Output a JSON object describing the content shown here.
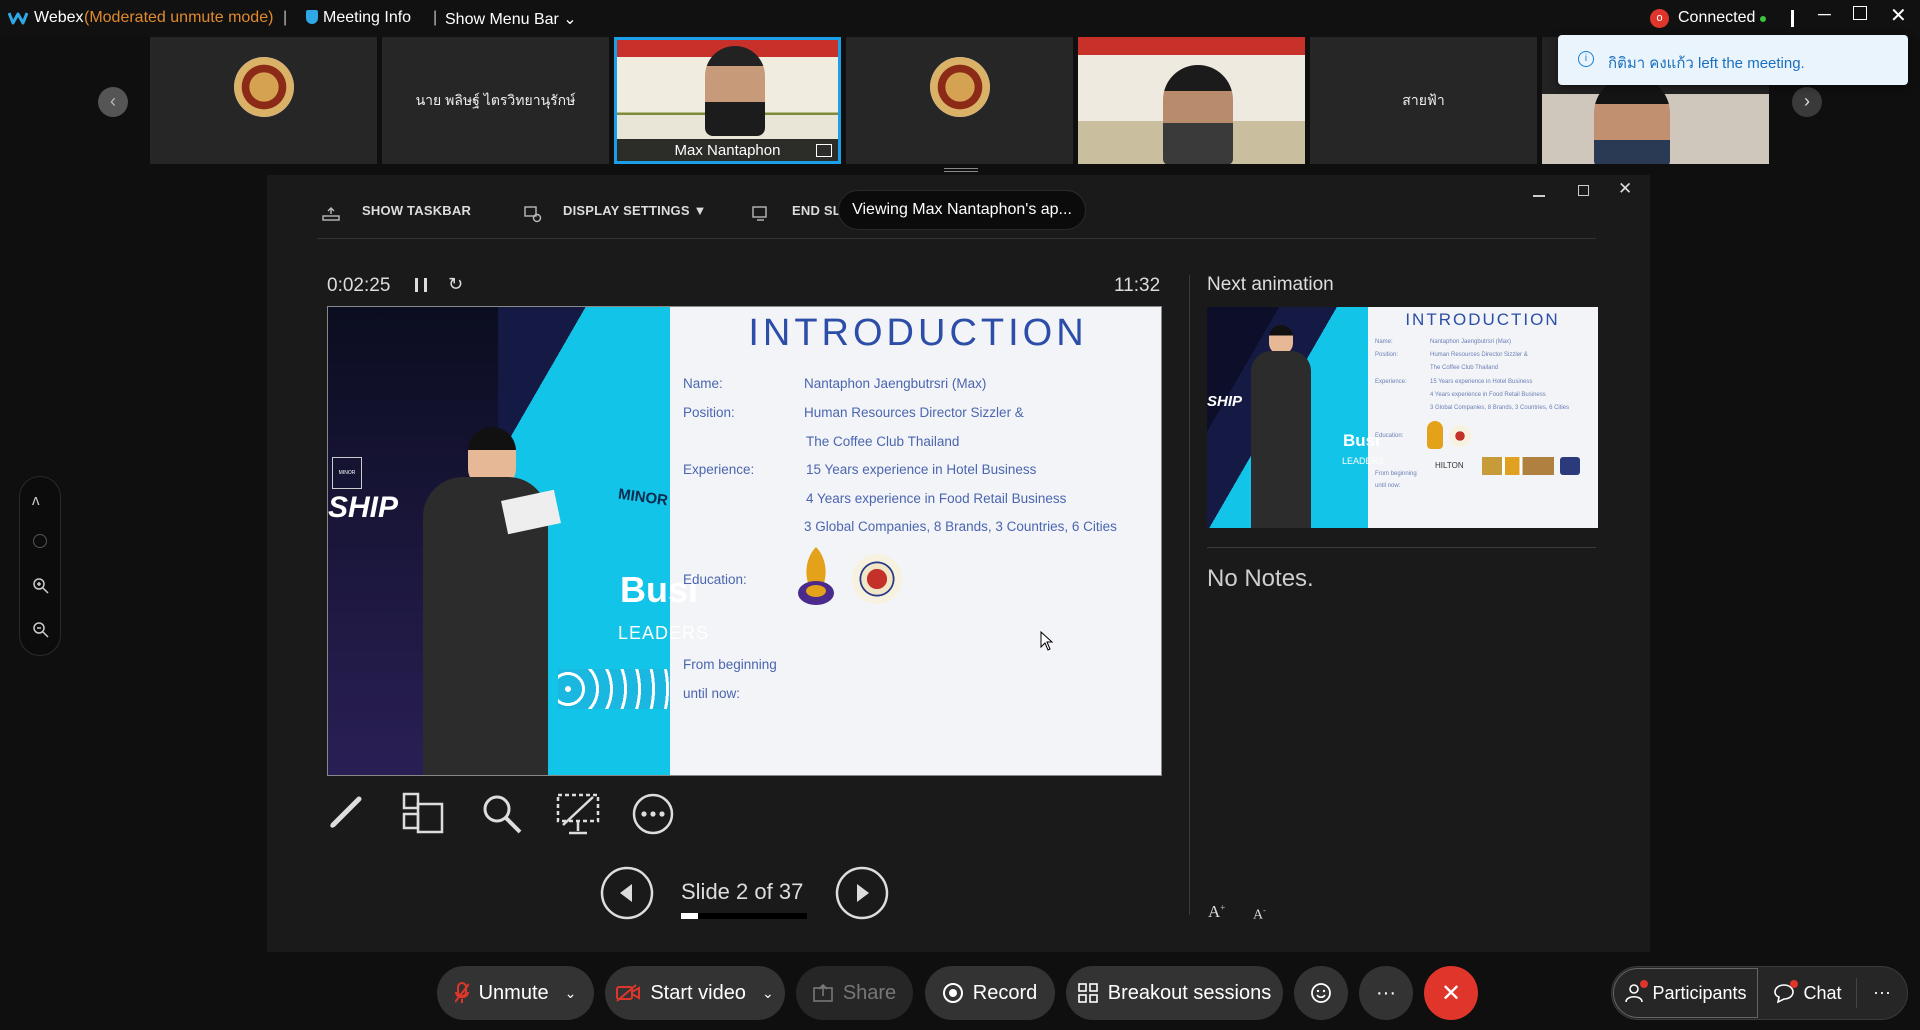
{
  "titlebar": {
    "app_name": "Webex",
    "mode": "(Moderated unmute mode)",
    "separator": "|",
    "meeting_info": "Meeting Info",
    "show_menu_bar": "Show Menu Bar",
    "connected": "Connected"
  },
  "toast": {
    "message": "กิติมา คงแก้ว left the meeting."
  },
  "filmstrip": {
    "tiles": [
      {
        "label": ""
      },
      {
        "label": "นาย พลิษฐ์ ไตรวิทยานุรักษ์"
      },
      {
        "label": "Max Nantaphon"
      },
      {
        "label": ""
      },
      {
        "label": ""
      },
      {
        "label": "สายฟ้า"
      },
      {
        "label": ""
      }
    ]
  },
  "presenter": {
    "show_taskbar": "SHOW TASKBAR",
    "display_settings": "DISPLAY SETTINGS ▼",
    "end_slideshow": "END SL",
    "viewing_banner": "Viewing Max Nantaphon's ap...",
    "elapsed": "0:02:25",
    "clock": "11:32",
    "next_animation": "Next animation",
    "notes": "No Notes.",
    "slide_counter": "Slide 2 of 37",
    "progress": 0.027
  },
  "slide": {
    "title": "INTRODUCTION",
    "photo_text_left": "SHIP",
    "photo_text_minor": "MINOR",
    "photo_text_bus": "Busi",
    "photo_text_leaders": "LEADERS",
    "name_label": "Name:",
    "name_value": "Nantaphon Jaengbutrsri (Max)",
    "position_label": "Position:",
    "position_value_1": "Human Resources Director Sizzler &",
    "position_value_2": "The Coffee Club Thailand",
    "experience_label": "Experience:",
    "experience_1": "15 Years experience in Hotel Business",
    "experience_2": "4  Years experience in Food Retail Business",
    "experience_3": "3 Global Companies, 8 Brands, 3 Countries, 6 Cities",
    "education_label": "Education:",
    "from_label_1": "From beginning",
    "from_label_2": "until now:"
  },
  "thumb": {
    "title": "INTRODUCTION",
    "lines": [
      "Name:",
      "Nantaphon Jaengbutrsri (Max)",
      "Position:",
      "Human Resources Director Sizzler &",
      "The Coffee Club Thailand",
      "Experience:",
      "15 Years experience in Hotel Business",
      "4  Years experience in Food Retail Business",
      "3 Global Companies, 8 Brands, 3 Countries, 6 Cities",
      "Education:",
      "From beginning",
      "until now:"
    ],
    "hilton": "HILTON"
  },
  "controls": {
    "unmute": "Unmute",
    "start_video": "Start video",
    "share": "Share",
    "record": "Record",
    "breakout": "Breakout sessions",
    "participants": "Participants",
    "chat": "Chat",
    "more": "···"
  },
  "colors": {
    "accent_blue": "#1aa0e8",
    "end_red": "#e0352b",
    "slide_blue": "#2c4ea8"
  }
}
